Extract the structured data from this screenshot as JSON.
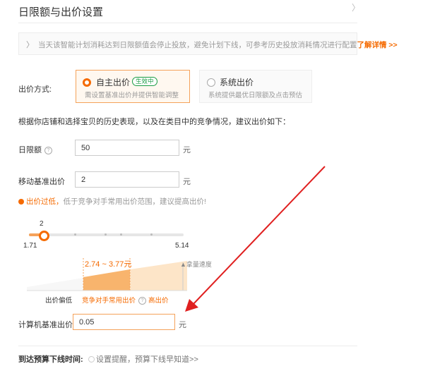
{
  "dialog": {
    "title": "日限额与出价设置",
    "close_glyph": "〉"
  },
  "notice": {
    "chevron": "〉",
    "text": "当天该智能计划消耗达到日限额值会停止投放，避免计划下线，可参考历史投放消耗情况进行配置",
    "link": "了解详情 >>"
  },
  "bid_mode": {
    "label": "出价方式:",
    "options": [
      {
        "title": "自主出价",
        "badge": "生效中",
        "subtitle": "需设置基准出价并提供智能调整",
        "selected": true
      },
      {
        "title": "系统出价",
        "subtitle": "系统提供最优日限额及点击预估",
        "selected": false
      }
    ]
  },
  "suggestion_text": "根据你店铺和选择宝贝的历史表现，以及在类目中的竞争情况，建议出价如下：",
  "daily_limit": {
    "label": "日限额",
    "value": "50",
    "unit": "元"
  },
  "mobile_bid": {
    "label": "移动基准出价",
    "value": "2",
    "unit": "元"
  },
  "warning": {
    "strong": "出价过低，",
    "text": "低于竞争对手常用出价范围，建议提高出价!"
  },
  "slider": {
    "current": "2",
    "min": "1.71",
    "max": "5.14",
    "position": 0.085
  },
  "range_chart": {
    "range_text": "2.74 ~ 3.77元",
    "y_label": "拿量速度",
    "legend": [
      "出价偏低",
      "竞争对手常用出价",
      "高出价"
    ]
  },
  "pc_bid": {
    "label": "计算机基准出价",
    "value": "0.05",
    "unit": "元"
  },
  "footer": {
    "label": "到达预算下线时间:",
    "text": "设置提醒，预算下线早知道>>"
  },
  "colors": {
    "accent": "#f56a00",
    "badge": "#1a9c43",
    "arrow": "#e02020"
  }
}
